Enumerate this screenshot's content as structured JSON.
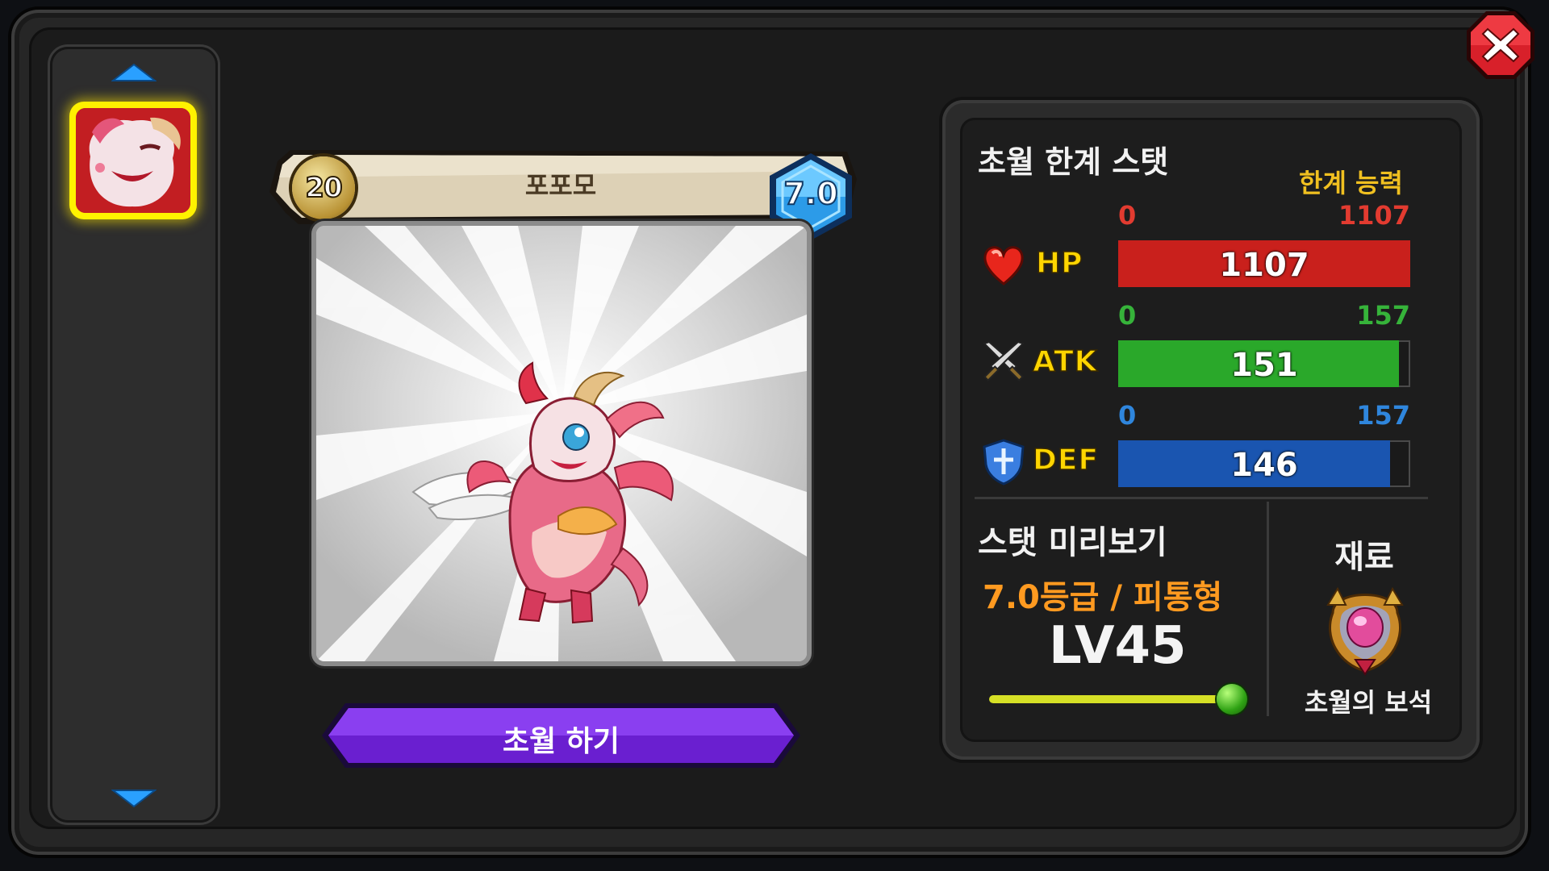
{
  "monster": {
    "name": "포포모",
    "level": "20",
    "grade": "7.0"
  },
  "actions": {
    "transcend_label": "초월 하기"
  },
  "stats_panel": {
    "title": "초월 한계 스탯",
    "limit_label": "한계 능력",
    "stats": [
      {
        "name": "HP",
        "min": "0",
        "max": "1107",
        "value": "1107",
        "fill": 1.0,
        "color": "#c9201c",
        "label_color": "#e23b30"
      },
      {
        "name": "ATK",
        "min": "0",
        "max": "157",
        "value": "151",
        "fill": 0.962,
        "color": "#2aa82a",
        "label_color": "#36b33a"
      },
      {
        "name": "DEF",
        "min": "0",
        "max": "157",
        "value": "146",
        "fill": 0.93,
        "color": "#1a55b0",
        "label_color": "#2f86dd"
      }
    ]
  },
  "preview": {
    "title": "스탯 미리보기",
    "grade_type": "7.0등급 / 피통형",
    "level": "LV45",
    "slider_value": 1.0
  },
  "material": {
    "label": "재료",
    "name": "초월의 보석"
  },
  "colors": {
    "accent_purple": "#6a1fd0",
    "gold": "#f0c020",
    "orange": "#ff9a20"
  },
  "icons": {
    "close": "close-icon",
    "up": "arrow-up-icon",
    "down": "arrow-down-icon",
    "hp": "heart-icon",
    "atk": "crossed-swords-icon",
    "def": "shield-icon",
    "material": "gem-icon"
  }
}
